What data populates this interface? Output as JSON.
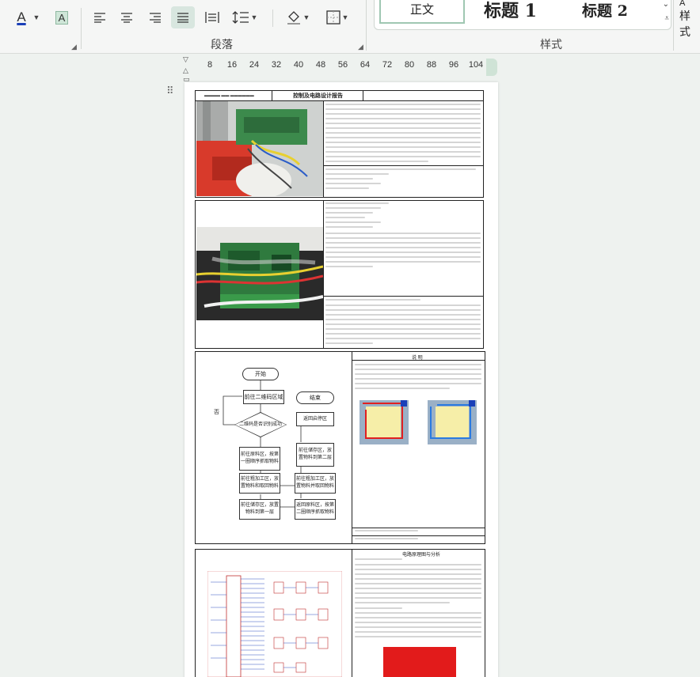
{
  "ribbon": {
    "font_color_icon": "A",
    "highlight_icon": "A",
    "paragraph_label": "段落",
    "styles_label": "样式",
    "styles_button": "样式",
    "styles": {
      "normal": "正文",
      "heading1": "标题 1",
      "heading2": "标题 2"
    },
    "accent_color": "#1a3fb8"
  },
  "ruler": {
    "ticks": [
      "8",
      "16",
      "24",
      "32",
      "40",
      "48",
      "56",
      "64",
      "72",
      "80",
      "88",
      "96",
      "104"
    ]
  },
  "document": {
    "report_title": "控制及电路设计报告",
    "flowchart": {
      "start": "开始",
      "scan": "前往二维码区域",
      "decision": "二维码是否识别成功",
      "no_label": "否",
      "go_raw": "前往原料区，按第一圈顺序抓取物料",
      "go_process": "前往粗加工区，放置物料和取回物料",
      "go_store": "前往储存区，放置物料到第一层",
      "go_raw2": "返回原料区，按第二圈顺序抓取物料",
      "go_process2": "前往粗加工区，放置物料并取回物料",
      "go_store2": "前往储存区，放置物料到第二层",
      "return": "返回启停区",
      "end": "结束"
    },
    "section_heading": "说 明",
    "schematic_heading": "电路原理图与分析"
  }
}
